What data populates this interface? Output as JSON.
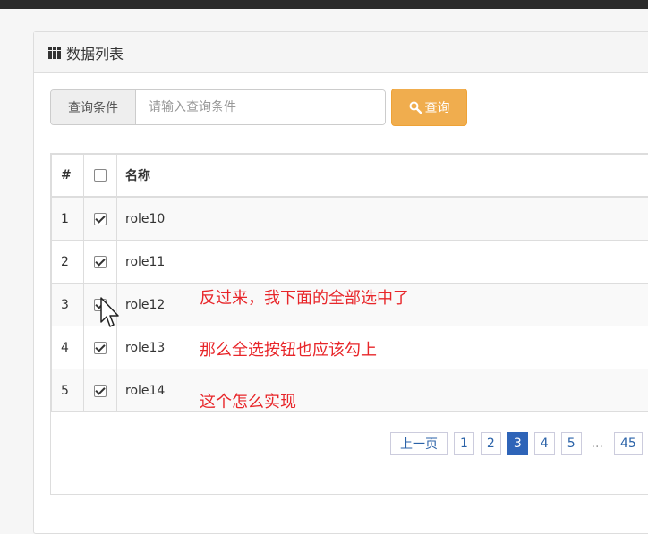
{
  "panel": {
    "title": "数据列表",
    "icon": "grid-icon"
  },
  "search": {
    "addon_label": "查询条件",
    "placeholder": "请输入查询条件",
    "value": "",
    "button_label": "查询",
    "button_color": "#f0ad4e"
  },
  "table": {
    "headers": {
      "index": "#",
      "name": "名称"
    },
    "header_checked": false,
    "rows": [
      {
        "index": "1",
        "name": "role10",
        "checked": true
      },
      {
        "index": "2",
        "name": "role11",
        "checked": true
      },
      {
        "index": "3",
        "name": "role12",
        "checked": true
      },
      {
        "index": "4",
        "name": "role13",
        "checked": true
      },
      {
        "index": "5",
        "name": "role14",
        "checked": true
      }
    ]
  },
  "pagination": {
    "prev_label": "上一页",
    "pages": [
      "1",
      "2",
      "3",
      "4",
      "5"
    ],
    "active_page": "3",
    "ellipsis": "...",
    "last_page": "45",
    "active_color": "#2e64b8"
  },
  "annotations": {
    "line1": "反过来，我下面的全部选中了",
    "line2": "那么全选按钮也应该勾上",
    "line3": "这个怎么实现",
    "color": "#e8262a"
  }
}
